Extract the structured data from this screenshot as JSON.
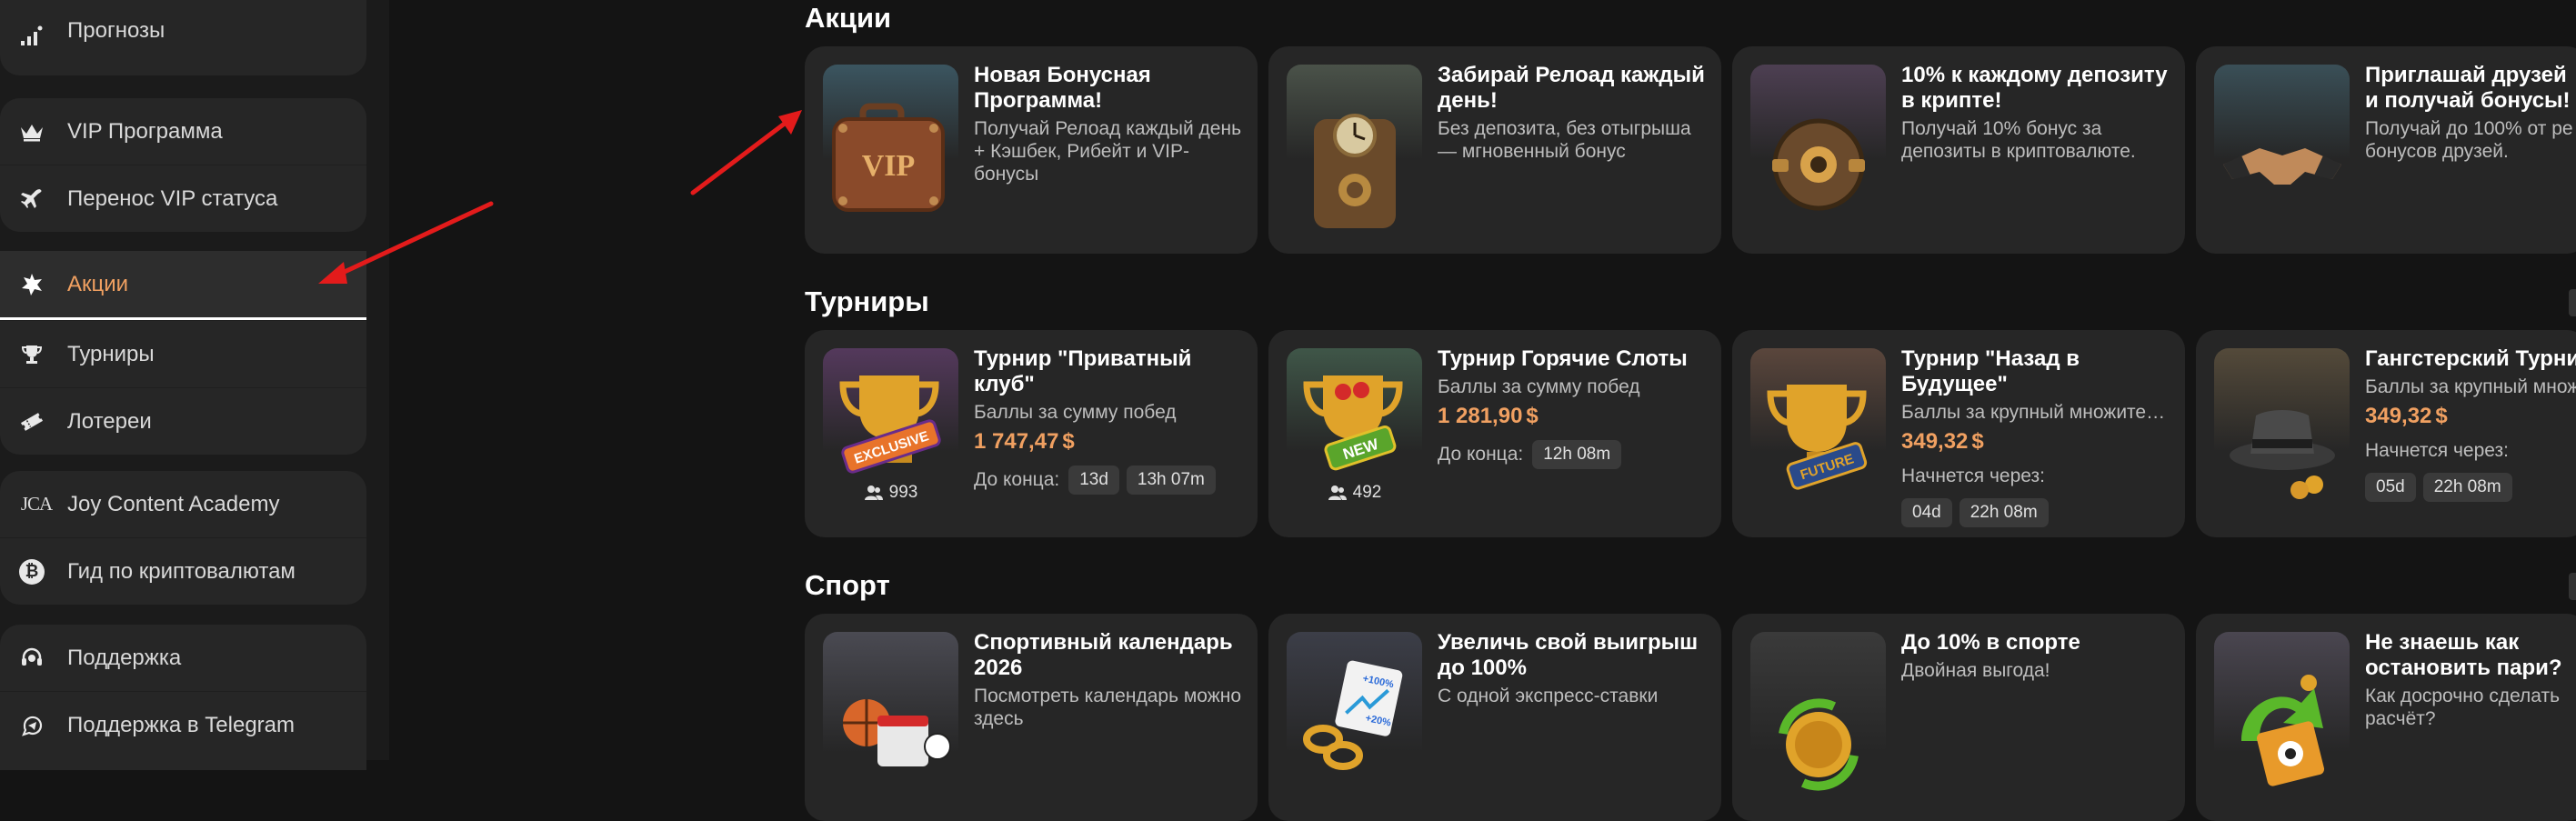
{
  "sidebar": {
    "groups": [
      {
        "items": [
          {
            "label": "Прогнозы",
            "icon": "chart-bars-icon"
          }
        ]
      },
      {
        "items": [
          {
            "label": "VIP Программа",
            "icon": "crown-icon"
          },
          {
            "label": "Перенос VIP статуса",
            "icon": "plane-icon"
          }
        ]
      },
      {
        "items": [
          {
            "label": "Акции",
            "icon": "star-burst-icon",
            "active": true
          },
          {
            "label": "Турниры",
            "icon": "trophy-icon"
          },
          {
            "label": "Лотереи",
            "icon": "ticket-icon"
          }
        ]
      },
      {
        "items": [
          {
            "label": "Joy Content Academy",
            "icon": "jca-logo-icon",
            "glyph": "JCA"
          },
          {
            "label": "Гид по криптовалютам",
            "icon": "bitcoin-icon",
            "glyph": "₿"
          }
        ]
      },
      {
        "items": [
          {
            "label": "Поддержка",
            "icon": "headset-icon"
          },
          {
            "label": "Поддержка в Telegram",
            "icon": "telegram-icon"
          }
        ]
      }
    ]
  },
  "sections": {
    "promos": {
      "title": "Акции",
      "cards": [
        {
          "title": "Новая Бонусная Программа!",
          "desc": "Получай Релоад каждый день + Кэшбек, Рибейт и VIP-бонусы",
          "image": "vip-suitcase",
          "thumb_color": "#3b5560"
        },
        {
          "title": "Забирай Релоад каждый день!",
          "desc": "Без депозита, без отыгрыша — мгновенный бонус",
          "image": "clock-machine",
          "thumb_color": "#4a5249"
        },
        {
          "title": "10% к каждому депозиту в крипте!",
          "desc": "Получай 10% бонус за депозиты в криптовалюте.",
          "image": "steampunk-helmet",
          "thumb_color": "#4d3f52"
        },
        {
          "title": "Приглашай друзей и получай бонусы!",
          "desc": "Получай до 100% от ре бонусов друзей.",
          "image": "handshake",
          "thumb_color": "#3a4f57"
        }
      ]
    },
    "tournaments": {
      "title": "Турниры",
      "cards": [
        {
          "title": "Турнир \"Приватный клуб\"",
          "desc": "Баллы за сумму побед",
          "amount": "1 747,47",
          "currency": "$",
          "timer_label": "До конца:",
          "chips": [
            "13d",
            "13h 07m"
          ],
          "players": "993",
          "badge": "EXCLUSIVE",
          "badge_color": "#e8732a",
          "thumb_color": "#54395c",
          "layout": "inline"
        },
        {
          "title": "Турнир Горячие Слоты",
          "desc": "Баллы за сумму побед",
          "amount": "1 281,90",
          "currency": "$",
          "timer_label": "До конца:",
          "chips": [
            "12h 08m"
          ],
          "players": "492",
          "badge": "NEW",
          "badge_color": "#5aa52b",
          "thumb_color": "#3f5648",
          "layout": "inline"
        },
        {
          "title": "Турнир \"Назад в Будущее\"",
          "desc": "Баллы за крупный множите…",
          "amount": "349,32",
          "currency": "$",
          "timer_label": "Начнется через:",
          "chips": [
            "04d",
            "22h 08m"
          ],
          "badge": "FUTURE",
          "badge_color": "#e0a32a",
          "thumb_color": "#5a463c",
          "layout": "stack"
        },
        {
          "title": "Гангстерский Турни",
          "desc": "Баллы за крупный множ",
          "amount": "349,32",
          "currency": "$",
          "timer_label": "Начнется через:",
          "chips": [
            "05d",
            "22h 08m"
          ],
          "thumb_color": "#544a3a",
          "layout": "stack"
        }
      ]
    },
    "sport": {
      "title": "Спорт",
      "cards": [
        {
          "title": "Спортивный календарь 2026",
          "desc": "Посмотреть календарь можно здесь",
          "thumb_color": "#4a4a52"
        },
        {
          "title": "Увеличь свой выигрыш до 100%",
          "desc": "С одной экспресс-ставки",
          "thumb_color": "#3c3e48",
          "badge_a": "+100%",
          "badge_b": "+20%"
        },
        {
          "title": "До 10% в спорте",
          "desc": "Двойная выгода!",
          "thumb_color": "#3a3a3a"
        },
        {
          "title": "Не знаешь как остановить пари?",
          "desc": "Как досрочно сделать расчёт?",
          "thumb_color": "#4a4650"
        }
      ]
    }
  },
  "annotations": {
    "arrow_color": "#e31b1b"
  }
}
